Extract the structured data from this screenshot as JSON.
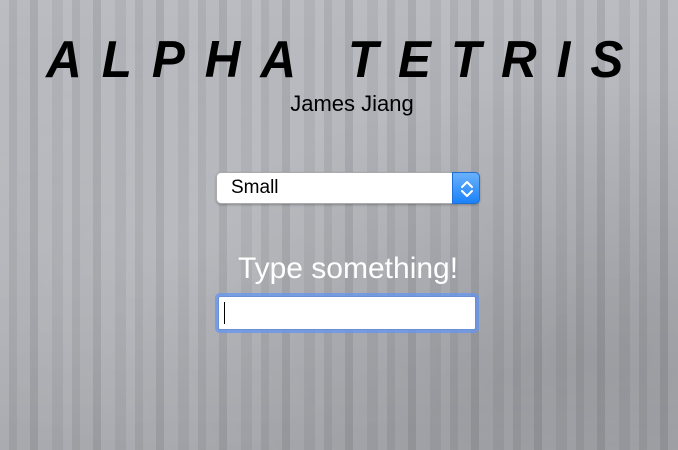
{
  "app": {
    "title": "ALPHA TETRIS",
    "author": "James Jiang"
  },
  "size_select": {
    "selected": "Small",
    "icon": "chevron-up-down-icon",
    "accent_color": "#1a82f9"
  },
  "prompt": {
    "label": "Type something!"
  },
  "text_input": {
    "value": "",
    "placeholder": ""
  }
}
